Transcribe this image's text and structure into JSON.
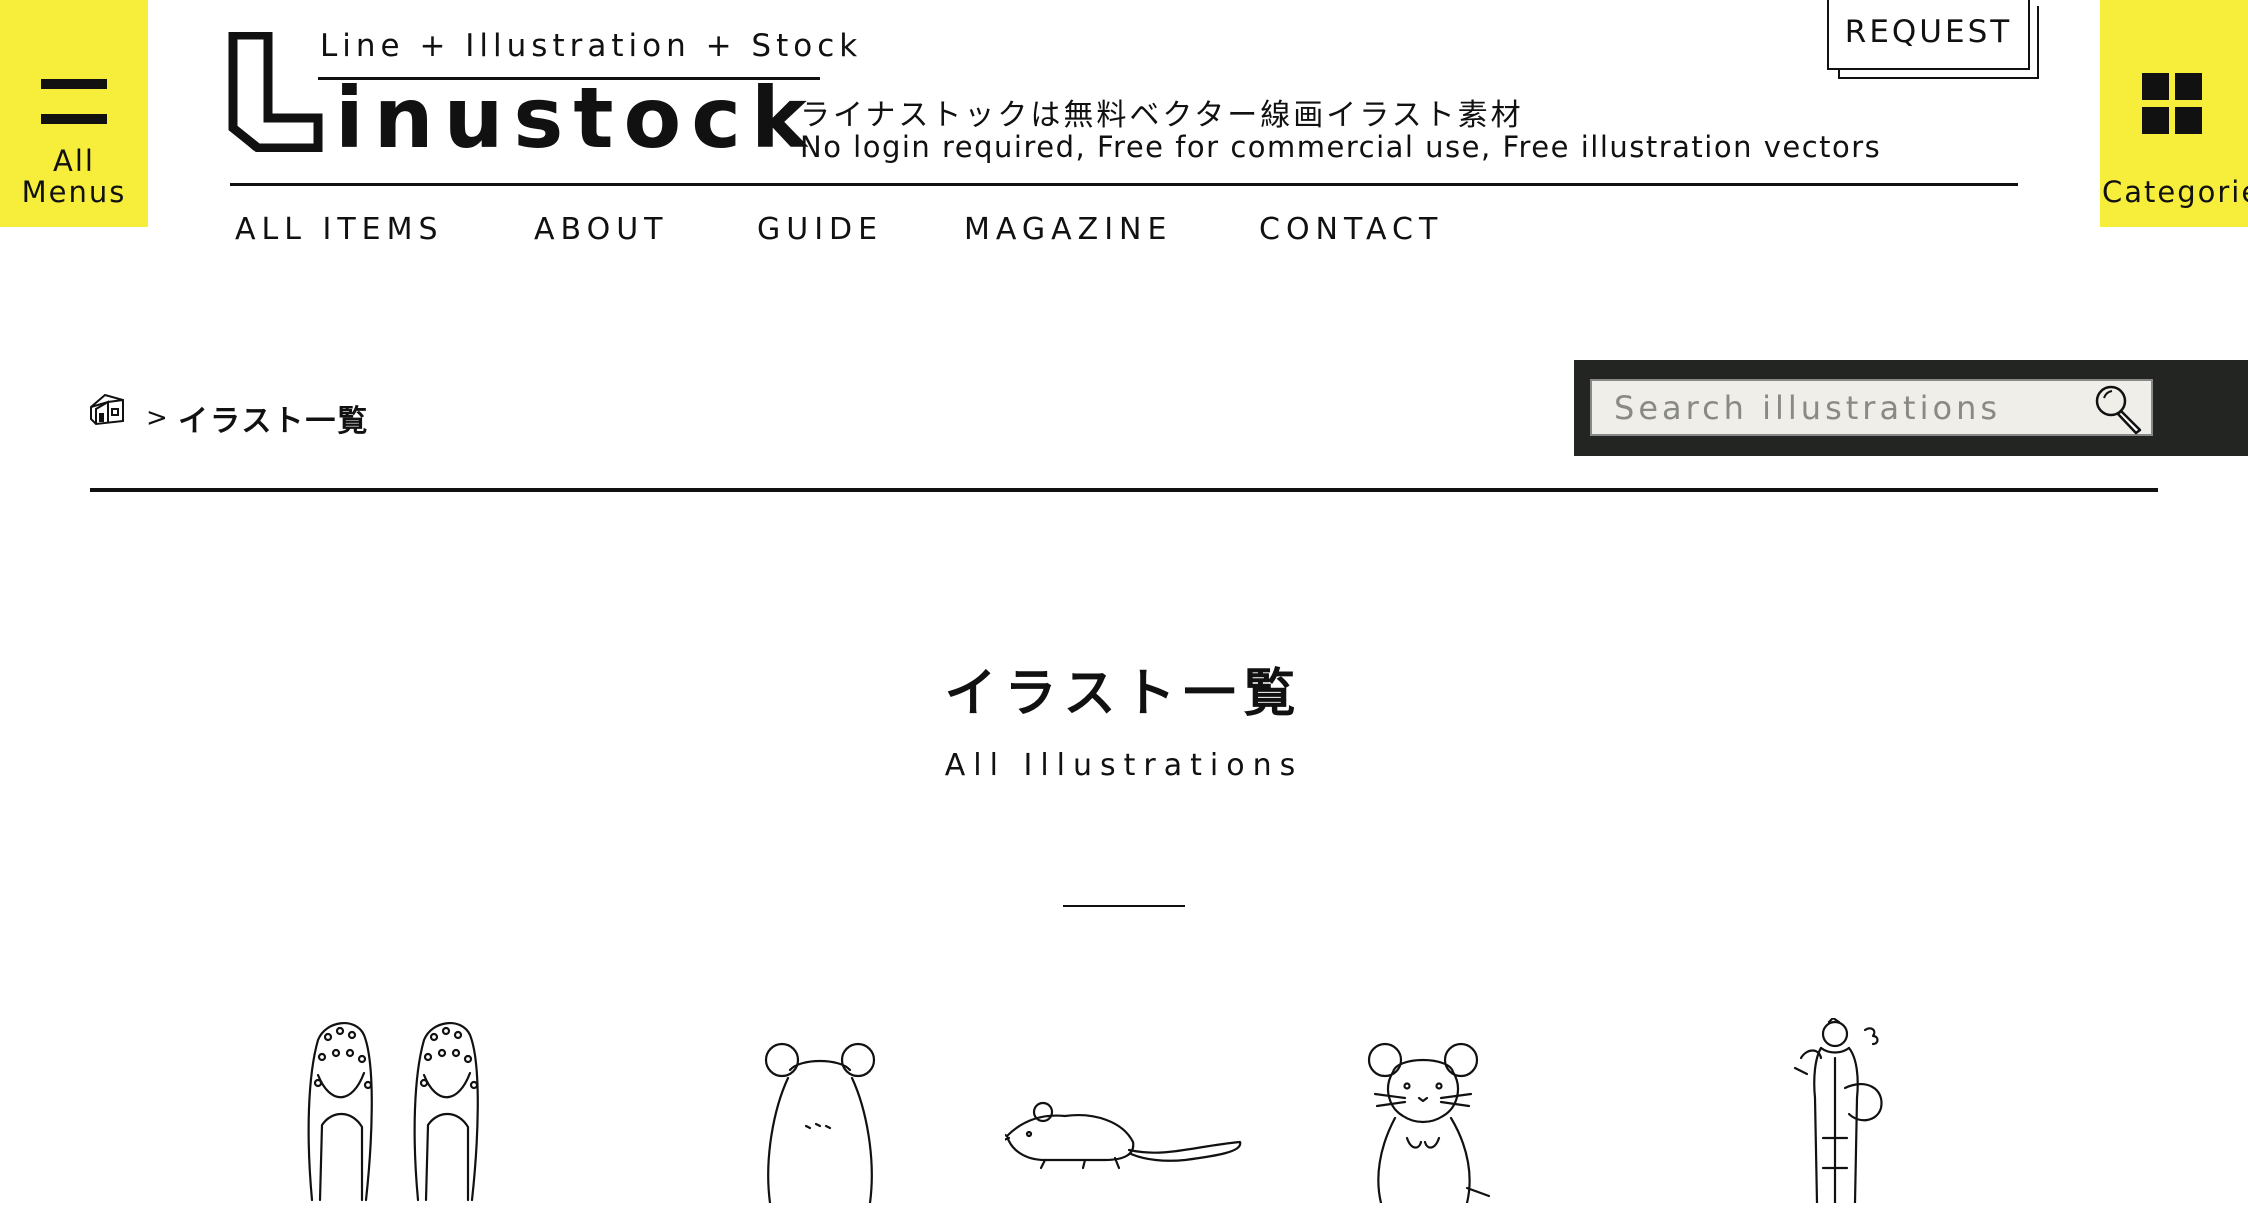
{
  "side": {
    "menu_label_1": "All",
    "menu_label_2": "Menus",
    "categories_label": "Categories"
  },
  "logo": {
    "tagline": "Line + Illustration + Stock",
    "word": "inustock",
    "desc_jp": "ライナストックは無料ベクター線画イラスト素材",
    "desc_en": "No login required, Free for commercial use, Free illustration vectors"
  },
  "header": {
    "request_label": "REQUEST"
  },
  "nav": [
    "ALL ITEMS",
    "ABOUT",
    "GUIDE",
    "MAGAZINE",
    "CONTACT"
  ],
  "breadcrumb": {
    "separator": ">",
    "current": "イラスト一覧"
  },
  "search": {
    "placeholder": "Search illustrations"
  },
  "page": {
    "title_jp": "イラスト一覧",
    "title_en": "All Illustrations"
  },
  "colors": {
    "accent_yellow": "#f6ee3b",
    "search_panel": "#222522",
    "text": "#111111"
  },
  "icons": [
    "menu-icon",
    "grid-icon",
    "home-icon",
    "search-icon"
  ]
}
